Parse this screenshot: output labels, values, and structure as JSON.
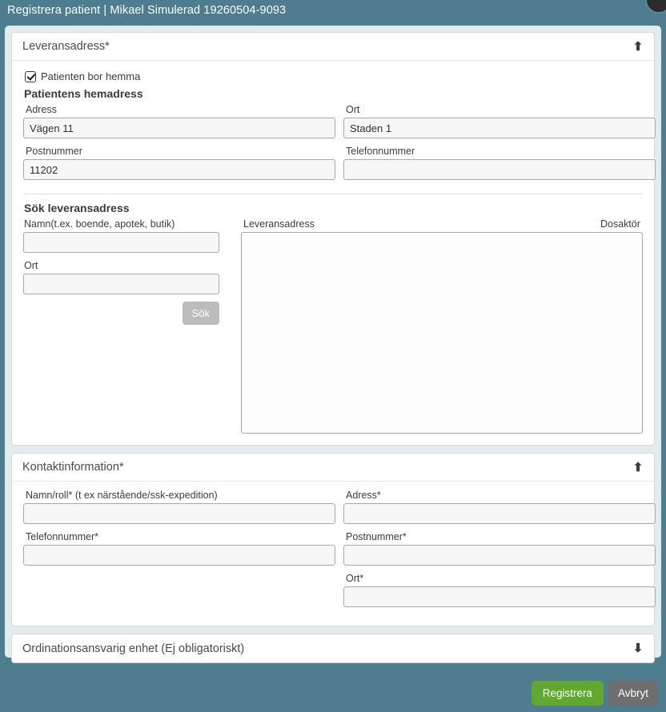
{
  "titlebar": {
    "text": "Registrera patient | Mikael Simulerad 19260504-9093"
  },
  "colors": {
    "page_background": "#4d7d8f",
    "container_background": "#e3ebee",
    "panel_background": "#ffffff",
    "register_button": "#60a830",
    "cancel_button": "#6e6e6e",
    "disabled_button": "#bcbcbc"
  },
  "sections": {
    "delivery": {
      "title": "Leveransadress*",
      "collapse_icon": "arrow-up-icon",
      "arrow_glyph": "⬆",
      "checkbox": {
        "label": "Patienten bor hemma",
        "checked": true
      },
      "home_address_heading": "Patientens hemadress",
      "fields": [
        {
          "label": "Adress",
          "value": "Vägen 11",
          "placeholder": ""
        },
        {
          "label": "Ort",
          "value": "Staden 1",
          "placeholder": ""
        },
        {
          "label": "Postnummer",
          "value": "11202",
          "placeholder": ""
        },
        {
          "label": "Telefonnummer",
          "value": "",
          "placeholder": ""
        }
      ],
      "search": {
        "heading": "Sök leveransadress",
        "name_label": "Namn(t.ex. boende, apotek, butik)",
        "name_value": "",
        "city_label": "Ort",
        "city_value": "",
        "button_label": "Sök",
        "button_disabled": true,
        "result_header_left": "Leveransadress",
        "result_header_right": "Dosaktör",
        "results": []
      }
    },
    "contact": {
      "title": "Kontaktinformation*",
      "collapse_icon": "arrow-up-icon",
      "arrow_glyph": "⬆",
      "fields": [
        {
          "label": "Namn/roll* (t ex närstående/ssk-expedition)",
          "value": "",
          "placeholder": ""
        },
        {
          "label": "Adress*",
          "value": "",
          "placeholder": ""
        },
        {
          "label": "Telefonnummer*",
          "value": "",
          "placeholder": ""
        },
        {
          "label": "Postnummer*",
          "value": "",
          "placeholder": ""
        },
        {
          "label": "Ort*",
          "value": "",
          "placeholder": ""
        }
      ]
    },
    "prescribing_unit": {
      "title": "Ordinationsansvarig enhet (Ej obligatoriskt)",
      "collapse_icon": "arrow-down-icon",
      "arrow_glyph": "⬇"
    }
  },
  "footer": {
    "register_label": "Registrera",
    "cancel_label": "Avbryt"
  }
}
